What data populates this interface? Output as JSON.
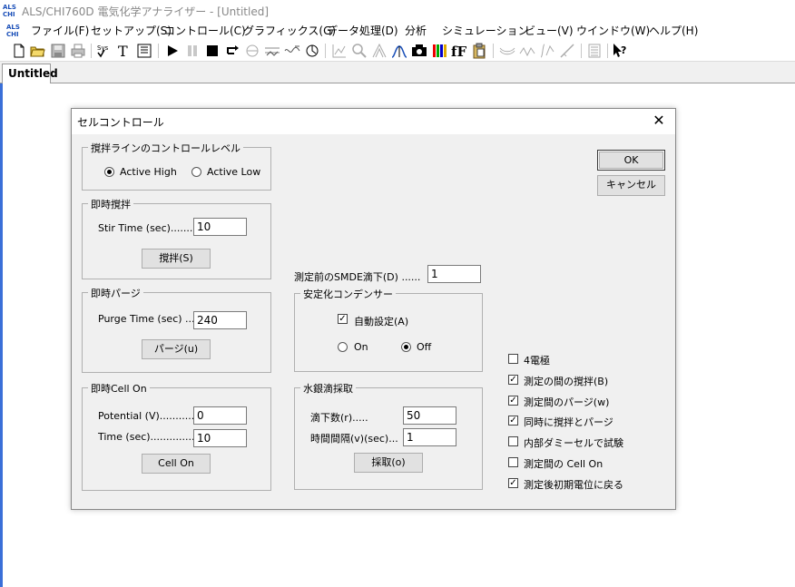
{
  "window": {
    "title": "ALS/CHI760D 電気化学アナライザー - [Untitled]",
    "logo_text": "ALS CHI"
  },
  "menu": [
    {
      "label": "ファイル(F)"
    },
    {
      "label": "セットアップ(S)"
    },
    {
      "label": "コントロール(C)"
    },
    {
      "label": "グラフィックス(G)"
    },
    {
      "label": "データ処理(D)"
    },
    {
      "label": "分析"
    },
    {
      "label": "シミュレーション"
    },
    {
      "label": "ビュー(V)"
    },
    {
      "label": "ウインドウ(W)"
    },
    {
      "label": "ヘルプ(H)"
    }
  ],
  "toolbar": {
    "icons": [
      "new-file-icon",
      "open-folder-icon",
      "save-icon",
      "print-icon",
      "sys-icon",
      "text-icon",
      "report-icon",
      "run-icon",
      "pause-icon",
      "stop-icon",
      "reverse-icon",
      "zero-current-icon",
      "filter-icon",
      "cell-icon",
      "rotate-icon",
      "graph-icon",
      "zoom-icon",
      "overlay-icon",
      "peak-icon",
      "camera-icon",
      "color-icon",
      "font-icon",
      "clipboard-icon",
      "smooth-icon",
      "derivative-icon",
      "integrate-icon",
      "baseline-icon",
      "report2-icon",
      "help-pointer-icon"
    ]
  },
  "tabs": [
    {
      "label": "Untitled"
    }
  ],
  "dialog": {
    "title": "セルコントロール",
    "ok_label": "OK",
    "cancel_label": "キャンセル",
    "stir_line": {
      "title": "撹拌ラインのコントロールレベル",
      "active_high": "Active High",
      "active_low": "Active Low",
      "selected": "Active High"
    },
    "instant_stir": {
      "title": "即時撹拌",
      "stir_time_label": "Stir Time (sec)..........",
      "stir_time_value": "10",
      "stir_button": "撹拌(S)"
    },
    "instant_purge": {
      "title": "即時パージ",
      "purge_time_label": "Purge Time (sec) ......",
      "purge_time_value": "240",
      "purge_button": "パージ(u)"
    },
    "instant_cell_on": {
      "title": "即時Cell On",
      "potential_label": "Potential (V)...............",
      "potential_value": "0",
      "time_label": "Time (sec).................",
      "time_value": "10",
      "cell_on_button": "Cell On"
    },
    "smde": {
      "label": "測定前のSMDE滴下(D) ......",
      "value": "1"
    },
    "stabilizer": {
      "title": "安定化コンデンサー",
      "auto_label": "自動設定(A)",
      "auto_checked": true,
      "on_label": "On",
      "off_label": "Off",
      "selected": "Off"
    },
    "mercury": {
      "title": "水銀滴採取",
      "drops_label": "滴下数(r).....",
      "drops_value": "50",
      "interval_label": "時間間隔(v)(sec)...",
      "interval_value": "1",
      "collect_button": "採取(o)"
    },
    "options": [
      {
        "label": "4電極",
        "checked": false
      },
      {
        "label": "測定の間の撹拌(B)",
        "checked": true
      },
      {
        "label": "測定間のパージ(w)",
        "checked": true
      },
      {
        "label": "同時に撹拌とパージ",
        "checked": true
      },
      {
        "label": "内部ダミーセルで試験",
        "checked": false
      },
      {
        "label": "測定間の Cell On",
        "checked": false
      },
      {
        "label": "測定後初期電位に戻る",
        "checked": true
      }
    ]
  }
}
